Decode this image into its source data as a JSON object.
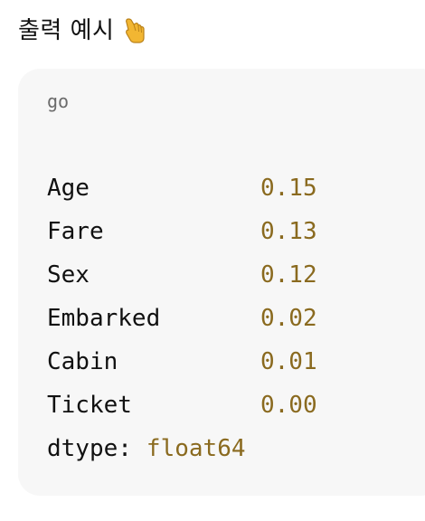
{
  "heading": {
    "text": "출력 예시",
    "icon": "hand-pointing-down-icon"
  },
  "code_block": {
    "language": "go",
    "rows": [
      {
        "key": "Age",
        "value": "0.15"
      },
      {
        "key": "Fare",
        "value": "0.13"
      },
      {
        "key": "Sex",
        "value": "0.12"
      },
      {
        "key": "Embarked",
        "value": "0.02"
      },
      {
        "key": "Cabin",
        "value": "0.01"
      },
      {
        "key": "Ticket",
        "value": "0.00"
      }
    ],
    "dtype_label": "dtype:",
    "dtype_value": "float64"
  },
  "colors": {
    "value_text": "#8a6a1f",
    "card_background": "#f7f7f7",
    "language_label": "#6b6b6b"
  }
}
